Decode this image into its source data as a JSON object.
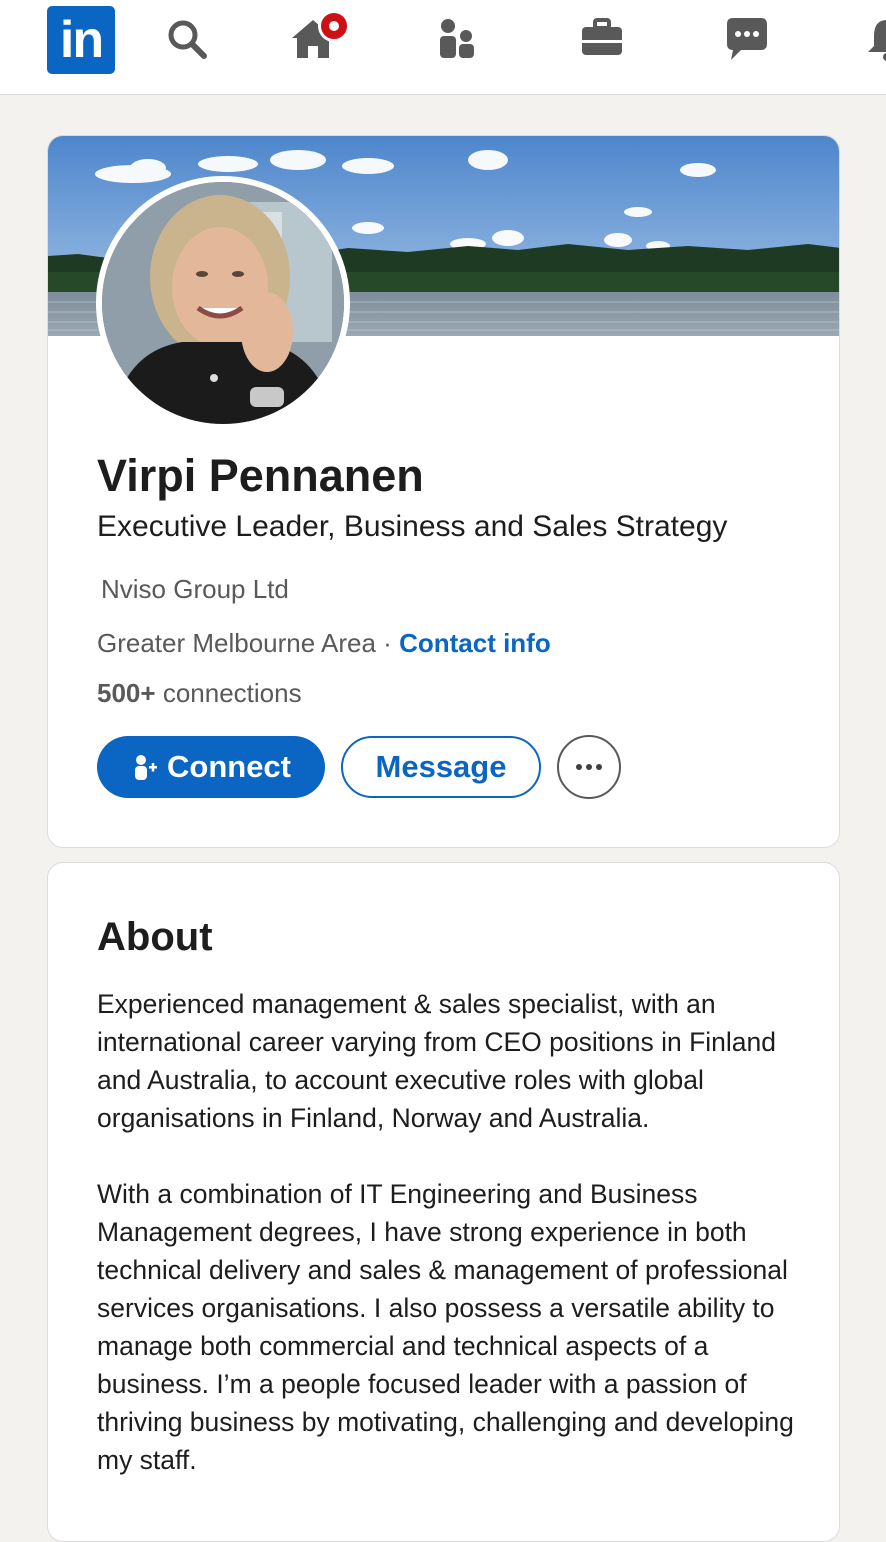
{
  "nav": {
    "logo_text": "in",
    "icons": [
      "linkedin-logo",
      "search-icon",
      "home-icon",
      "network-icon",
      "jobs-icon",
      "messaging-icon",
      "notifications-icon"
    ],
    "accent_color": "#0a66c2",
    "badge_color": "#cc1016"
  },
  "profile": {
    "name": "Virpi Pennanen",
    "headline": "Executive Leader, Business and Sales Strategy",
    "company": "Nviso Group Ltd",
    "location": "Greater Melbourne Area",
    "separator": "·",
    "contact_label": "Contact info",
    "connections_count": "500+",
    "connections_label": "connections",
    "connect_label": "Connect",
    "message_label": "Message"
  },
  "about": {
    "title": "About",
    "paragraph_1": "Experienced management & sales specialist, with an international career varying from CEO positions in Finland and Australia, to account executive roles with global organisations in Finland, Norway and Australia.",
    "paragraph_2": "With a combination of IT Engineering and Business Management degrees, I have strong experience in both technical delivery and sales & management of professional services organisations. I also possess a versatile ability to manage both commercial and technical aspects of a business. I’m a people focused leader with a passion of thriving business by motivating, challenging and developing my staff."
  }
}
